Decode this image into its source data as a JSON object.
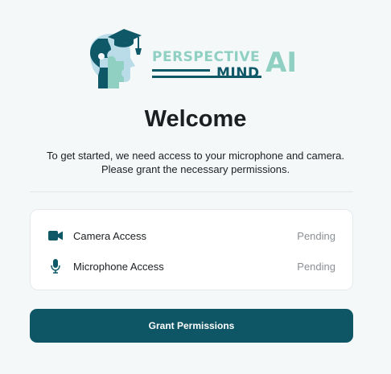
{
  "logo": {
    "line1": "PERSPECTIVE",
    "line2": "MIND",
    "suffix": "AI",
    "colors": {
      "mint": "#8fd0c3",
      "teal": "#0f5868",
      "light_blue": "#b9dce8"
    }
  },
  "title": "Welcome",
  "subtitle": {
    "line1": "To get started, we need access to your microphone and camera.",
    "line2": "Please grant the necessary permissions."
  },
  "permissions": [
    {
      "icon": "video-camera-icon",
      "label": "Camera Access",
      "status": "Pending"
    },
    {
      "icon": "microphone-icon",
      "label": "Microphone Access",
      "status": "Pending"
    }
  ],
  "grant_button": {
    "label": "Grant Permissions"
  },
  "colors": {
    "accent": "#0e5666",
    "status_pending": "#8a9096"
  }
}
